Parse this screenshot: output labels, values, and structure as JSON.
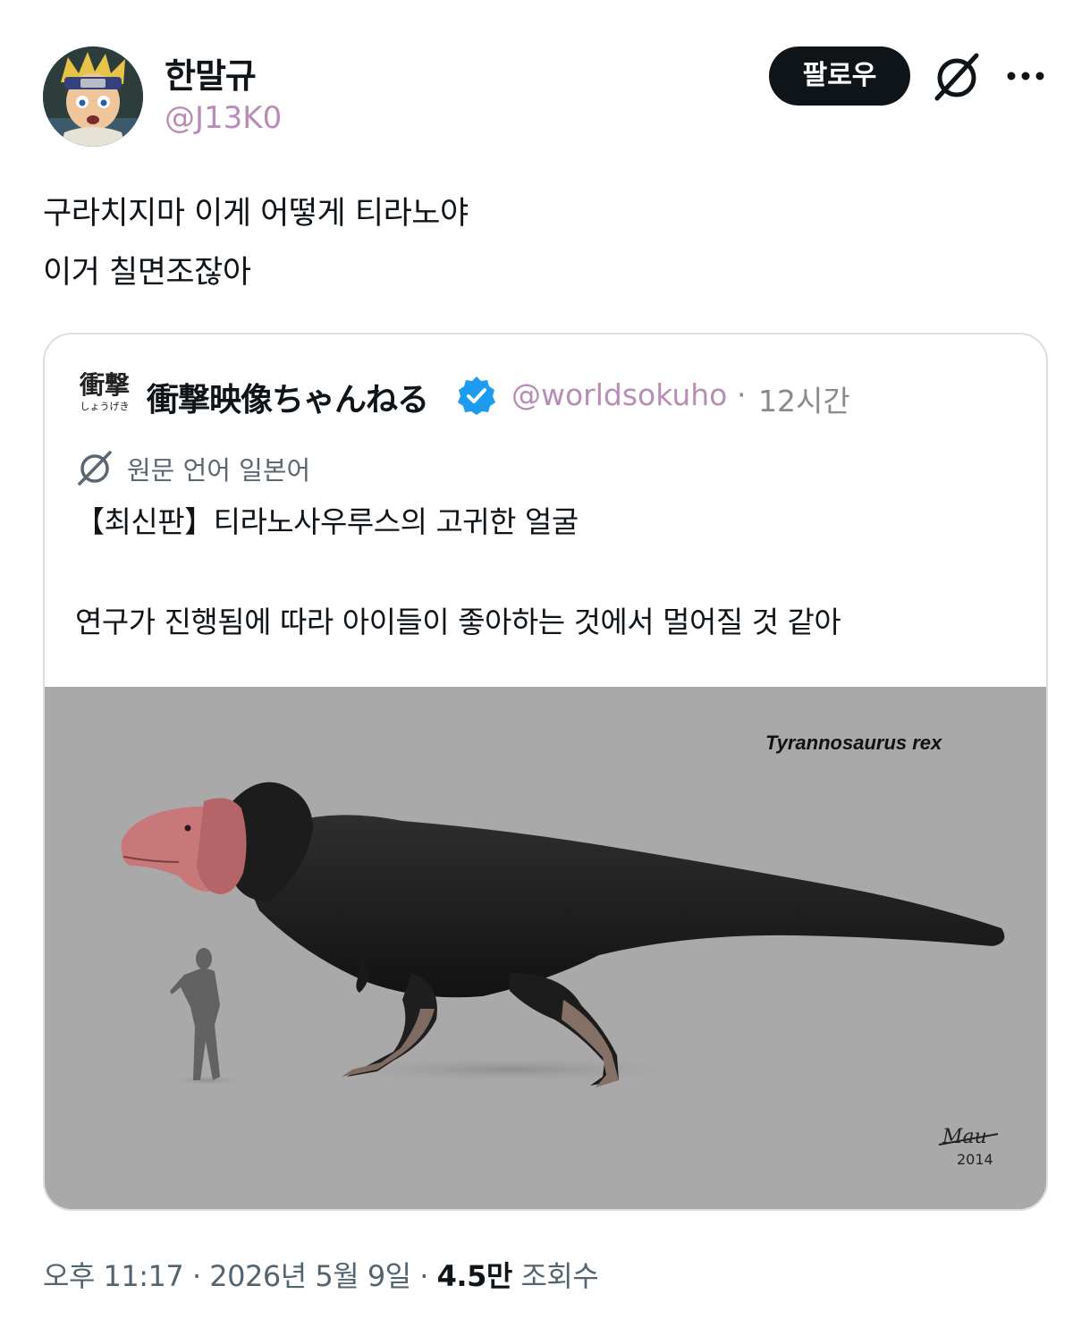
{
  "author": {
    "name": "한말규",
    "handle": "@J13K0"
  },
  "actions": {
    "follow_label": "팔로우",
    "grok_icon": "grok-slash-icon",
    "more_icon": "more-dots-icon"
  },
  "tweet": {
    "lines": [
      "구라치지마 이게 어떻게 티라노야",
      "이거 칠면조잖아"
    ]
  },
  "quote": {
    "avatar_text": "衝撃",
    "avatar_kana": "しょうげき",
    "name": "衝撃映像ちゃんねる",
    "verified_icon": "verified-badge-icon",
    "handle": "@worldsokuho",
    "separator": "·",
    "time": "12시간",
    "translate_label": "원문 언어 일본어",
    "lines": [
      "【최신판】티라노사우루스의 고귀한 얼굴",
      "",
      "연구가 진행됨에 따라 아이들이 좋아하는 것에서 멀어질 것 같아"
    ],
    "media": {
      "caption": "Tyrannosaurus rex",
      "signature": "Mau",
      "year": "2014"
    }
  },
  "meta": {
    "time": "오후 11:17",
    "sep1": "·",
    "date": "2026년 5월 9일",
    "sep2": "·",
    "views_count": "4.5만",
    "views_label": "조회수"
  },
  "colors": {
    "handle": "#b98bb7",
    "follow_bg": "#0f1419",
    "verified": "#1d9bf0",
    "media_bg": "#a9a9a9"
  }
}
